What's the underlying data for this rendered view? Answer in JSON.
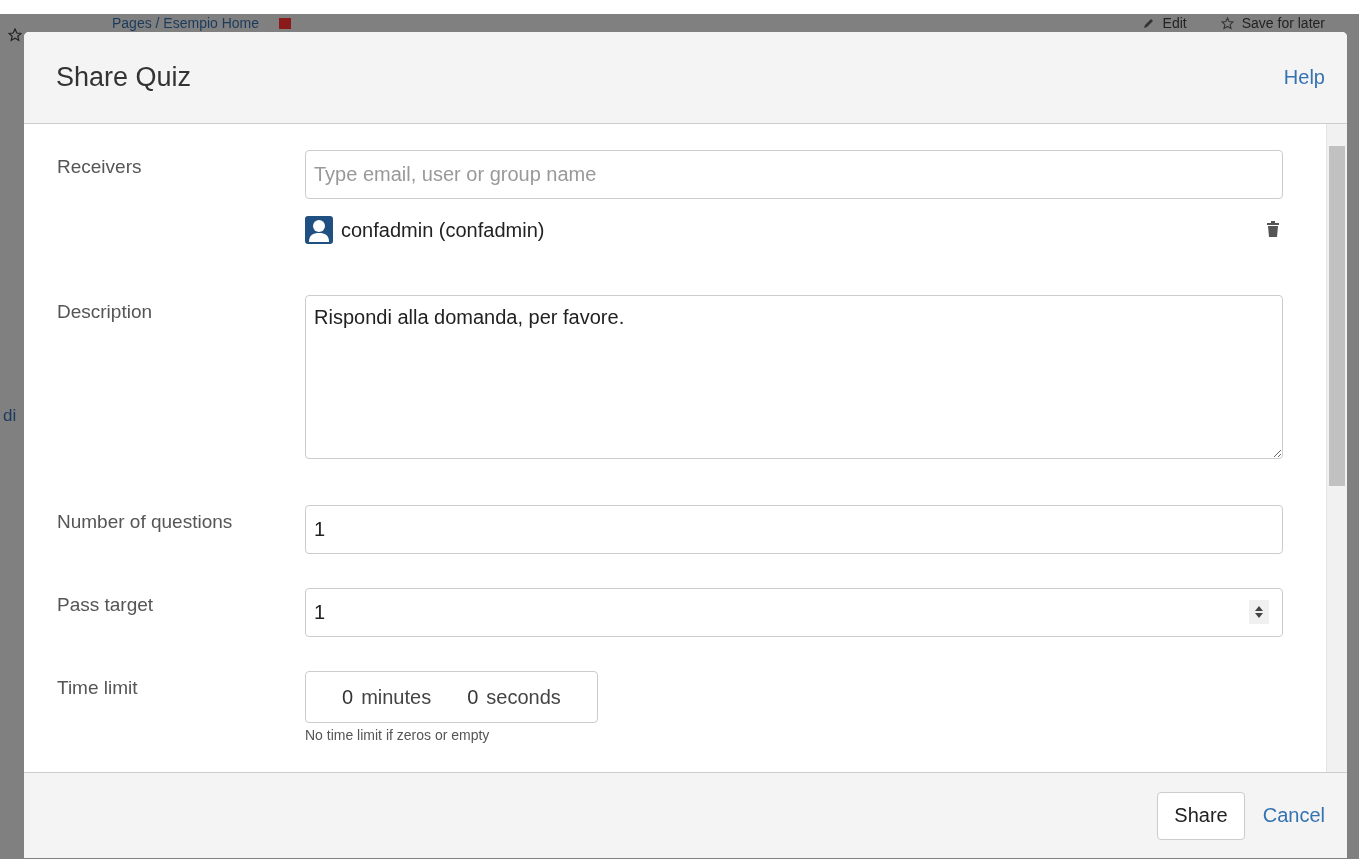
{
  "background_page": {
    "breadcrumb": "Pages / Esempio Home",
    "actions": [
      {
        "label": "Edit",
        "kind": "edit"
      },
      {
        "label": "Save for later",
        "kind": "save"
      }
    ],
    "side_text": "di"
  },
  "dialog": {
    "title": "Share Quiz",
    "help_link": "Help",
    "fields": [
      {
        "kind": "receivers",
        "label": "Receivers",
        "placeholder": "Type email, user or group name",
        "receivers": [
          {
            "name": "confadmin (confadmin)"
          }
        ]
      },
      {
        "kind": "textarea",
        "label": "Description",
        "value": "Rispondi alla domanda, per favore."
      },
      {
        "kind": "text",
        "label": "Number of questions",
        "value": "1"
      },
      {
        "kind": "number",
        "label": "Pass target",
        "value": "1"
      },
      {
        "kind": "time",
        "label": "Time limit",
        "minutes": "0",
        "minutes_unit": "minutes",
        "seconds": "0",
        "seconds_unit": "seconds",
        "hint": "No time limit if zeros or empty"
      }
    ],
    "buttons": [
      {
        "label": "Share",
        "kind": "button"
      },
      {
        "label": "Cancel",
        "kind": "link"
      }
    ]
  }
}
